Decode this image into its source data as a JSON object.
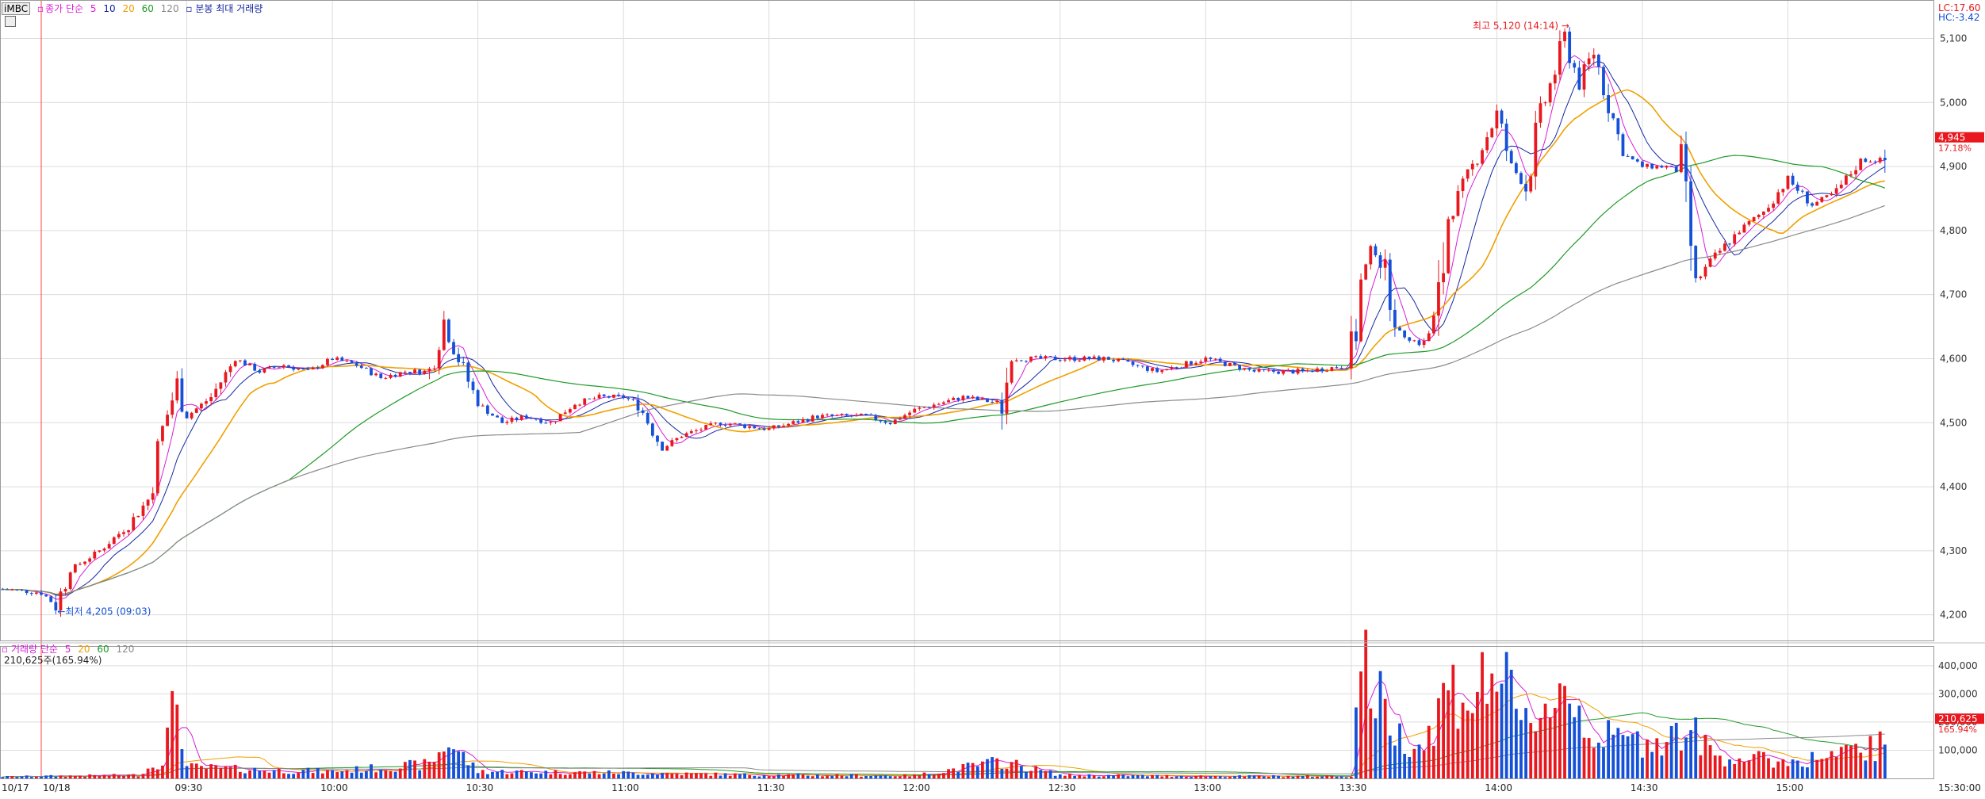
{
  "header": {
    "symbol": "iMBC",
    "price_legend_prefix": "▫",
    "price_legend_label": "종가 단순",
    "ma_periods": [
      "5",
      "10",
      "20",
      "60",
      "120"
    ],
    "extra_label": "▫ 분봉 최대 거래량",
    "lc": "LC:17.60",
    "hc": "HC:-3.42"
  },
  "volume_header": {
    "label": "▫ 거래량 단순",
    "ma_periods": [
      "5",
      "20",
      "60",
      "120"
    ],
    "current": "210,625주(165.94%)"
  },
  "annotations": {
    "high": "최고 5,120 (14:14)",
    "low": "최저 4,205 (09:03)",
    "last_price": "4,945",
    "last_change": "17.18%",
    "last_volume": "210,625",
    "last_volume_pct": "165.94%"
  },
  "colors": {
    "up": "#e8181e",
    "down": "#1450d8",
    "ma5": "#d81ed8",
    "ma10": "#1428a0",
    "ma20": "#f0a000",
    "ma60": "#1e9a28",
    "ma120": "#8a8a8a",
    "grid": "#dcdcdc",
    "vline": "#ff4040"
  },
  "chart_data": {
    "type": "candlestick",
    "price_axis": {
      "ylim": [
        4160,
        5160
      ],
      "ticks": [
        4200,
        4300,
        4400,
        4500,
        4600,
        4700,
        4800,
        4900,
        5000,
        5100
      ],
      "tick_labels": [
        "4,200",
        "4,300",
        "4,400",
        "4,500",
        "4,600",
        "4,700",
        "4,800",
        "4,900",
        "5,000",
        "5,100"
      ]
    },
    "volume_axis": {
      "ylim": [
        0,
        470000
      ],
      "ticks": [
        100000,
        200000,
        300000,
        400000
      ],
      "tick_labels": [
        "100,000",
        "200,000",
        "300,000",
        "400,000"
      ]
    },
    "time_axis": {
      "labels": [
        "10/17",
        "10/18",
        "09:30",
        "10:00",
        "10:30",
        "11:00",
        "11:30",
        "12:00",
        "12:30",
        "13:00",
        "13:30",
        "14:00",
        "14:30",
        "15:00",
        "15:30:00"
      ],
      "label_times": [
        "-",
        "09:00",
        "09:30",
        "10:00",
        "10:30",
        "11:00",
        "11:30",
        "12:00",
        "12:30",
        "13:00",
        "13:30",
        "14:00",
        "14:30",
        "15:00",
        "15:30"
      ]
    },
    "day_boundary_time": "09:00",
    "series_names": [
      "5",
      "10",
      "20",
      "60",
      "120"
    ],
    "price_keypoints": [
      [
        "08:52",
        4240
      ],
      [
        "09:00",
        4235
      ],
      [
        "09:03",
        4215
      ],
      [
        "09:06",
        4270
      ],
      [
        "09:12",
        4300
      ],
      [
        "09:18",
        4340
      ],
      [
        "09:22",
        4380
      ],
      [
        "09:25",
        4490
      ],
      [
        "09:28",
        4560
      ],
      [
        "09:30",
        4510
      ],
      [
        "09:35",
        4540
      ],
      [
        "09:40",
        4600
      ],
      [
        "09:45",
        4580
      ],
      [
        "09:50",
        4590
      ],
      [
        "09:55",
        4580
      ],
      [
        "10:00",
        4600
      ],
      [
        "10:05",
        4590
      ],
      [
        "10:10",
        4570
      ],
      [
        "10:15",
        4580
      ],
      [
        "10:20",
        4580
      ],
      [
        "10:23",
        4660
      ],
      [
        "10:26",
        4600
      ],
      [
        "10:30",
        4530
      ],
      [
        "10:35",
        4500
      ],
      [
        "10:40",
        4510
      ],
      [
        "10:45",
        4500
      ],
      [
        "10:50",
        4530
      ],
      [
        "10:55",
        4540
      ],
      [
        "11:00",
        4540
      ],
      [
        "11:03",
        4530
      ],
      [
        "11:08",
        4460
      ],
      [
        "11:12",
        4480
      ],
      [
        "11:20",
        4500
      ],
      [
        "11:30",
        4490
      ],
      [
        "11:40",
        4510
      ],
      [
        "11:50",
        4510
      ],
      [
        "11:55",
        4500
      ],
      [
        "12:00",
        4520
      ],
      [
        "12:10",
        4540
      ],
      [
        "12:18",
        4530
      ],
      [
        "12:20",
        4600
      ],
      [
        "12:30",
        4600
      ],
      [
        "12:40",
        4600
      ],
      [
        "12:50",
        4580
      ],
      [
        "13:00",
        4600
      ],
      [
        "13:10",
        4580
      ],
      [
        "13:20",
        4580
      ],
      [
        "13:30",
        4590
      ],
      [
        "13:32",
        4720
      ],
      [
        "13:35",
        4780
      ],
      [
        "13:37",
        4730
      ],
      [
        "13:40",
        4640
      ],
      [
        "13:45",
        4620
      ],
      [
        "13:48",
        4680
      ],
      [
        "13:50",
        4820
      ],
      [
        "13:55",
        4900
      ],
      [
        "14:00",
        4980
      ],
      [
        "14:03",
        4900
      ],
      [
        "14:06",
        4870
      ],
      [
        "14:09",
        4980
      ],
      [
        "14:12",
        5050
      ],
      [
        "14:14",
        5100
      ],
      [
        "14:17",
        5030
      ],
      [
        "14:20",
        5080
      ],
      [
        "14:23",
        5000
      ],
      [
        "14:26",
        4920
      ],
      [
        "14:30",
        4900
      ],
      [
        "14:35",
        4900
      ],
      [
        "14:38",
        4890
      ],
      [
        "14:41",
        4720
      ],
      [
        "14:45",
        4760
      ],
      [
        "14:50",
        4800
      ],
      [
        "14:55",
        4830
      ],
      [
        "15:00",
        4880
      ],
      [
        "15:05",
        4840
      ],
      [
        "15:10",
        4860
      ],
      [
        "15:15",
        4910
      ],
      [
        "15:20",
        4910
      ],
      [
        "15:20",
        4945
      ]
    ],
    "volume_keypoints": [
      [
        "08:52",
        6000
      ],
      [
        "09:00",
        8000
      ],
      [
        "09:20",
        12000
      ],
      [
        "09:25",
        70000
      ],
      [
        "09:28",
        300000
      ],
      [
        "09:30",
        40000
      ],
      [
        "09:45",
        30000
      ],
      [
        "10:00",
        25000
      ],
      [
        "10:20",
        50000
      ],
      [
        "10:24",
        130000
      ],
      [
        "10:30",
        25000
      ],
      [
        "11:00",
        20000
      ],
      [
        "11:30",
        12000
      ],
      [
        "12:00",
        10000
      ],
      [
        "12:18",
        60000
      ],
      [
        "12:30",
        12000
      ],
      [
        "13:00",
        8000
      ],
      [
        "13:30",
        8000
      ],
      [
        "13:32",
        440000
      ],
      [
        "13:35",
        300000
      ],
      [
        "13:40",
        150000
      ],
      [
        "13:45",
        120000
      ],
      [
        "13:50",
        330000
      ],
      [
        "13:55",
        280000
      ],
      [
        "14:00",
        400000
      ],
      [
        "14:05",
        180000
      ],
      [
        "14:10",
        260000
      ],
      [
        "14:14",
        330000
      ],
      [
        "14:20",
        150000
      ],
      [
        "14:30",
        130000
      ],
      [
        "14:40",
        170000
      ],
      [
        "14:45",
        80000
      ],
      [
        "15:00",
        60000
      ],
      [
        "15:10",
        80000
      ],
      [
        "15:20",
        120000
      ],
      [
        "15:20",
        210625
      ]
    ]
  }
}
